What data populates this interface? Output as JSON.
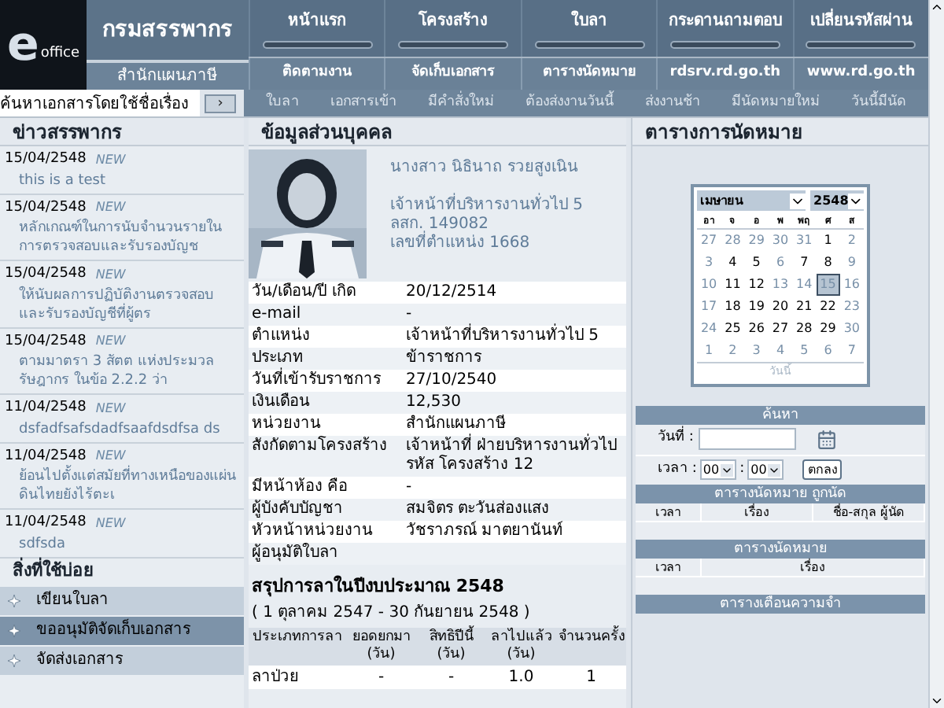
{
  "header": {
    "logo_letter": "e",
    "logo_word": "office",
    "title": "กรมสรรพากร",
    "subtitle": "สำนักแผนภาษี"
  },
  "nav_top": [
    "หน้าแรก",
    "โครงสร้าง",
    "ใบลา",
    "กระดานถามตอบ",
    "เปลี่ยนรหัสผ่าน"
  ],
  "nav_bottom": [
    "ติดตามงาน",
    "จัดเก็บเอกสาร",
    "ตารางนัดหมาย",
    "rdsrv.rd.go.th",
    "www.rd.go.th"
  ],
  "search": {
    "value": "ค้นหาเอกสารโดยใช้ชื่อเรื่อง",
    "button": "›"
  },
  "alerts": [
    {
      "label": "ใบลา",
      "active": false
    },
    {
      "label": "เอกสารเข้า",
      "active": false
    },
    {
      "label": "มีคำสั่งใหม่",
      "active": false
    },
    {
      "label": "ต้องส่งงานวันนี้",
      "active": false
    },
    {
      "label": "ส่งงานช้า",
      "active": false
    },
    {
      "label": "มีนัดหมายใหม่",
      "active": false
    },
    {
      "label": "วันนี้มีนัด",
      "active": false
    }
  ],
  "news": {
    "title": "ข่าวสรรพากร",
    "items": [
      {
        "date": "15/04/2548",
        "badge": "NEW",
        "text": "this is a test"
      },
      {
        "date": "15/04/2548",
        "badge": "NEW",
        "text": "หลักเกณฑ์ในการนับจำนวนรายในการตรวจสอบและรับรองบัญช"
      },
      {
        "date": "15/04/2548",
        "badge": "NEW",
        "text": "ให้นับผลการปฏิบัติงานตรวจสอบและรับรองบัญชีที่ผู้ตร"
      },
      {
        "date": "15/04/2548",
        "badge": "NEW",
        "text": "ตามมาตรา 3 สัตต แห่งประมวลรัษฎากร ในข้อ 2.2.2 ว่า"
      },
      {
        "date": "11/04/2548",
        "badge": "NEW",
        "text": "dsfadfsafsdadfsaafdsdfsa ds"
      },
      {
        "date": "11/04/2548",
        "badge": "NEW",
        "text": "ย้อนไปตั้งแต่สมัยที่ทางเหนือของแผ่นดินไทยยังไร้ตะเ"
      },
      {
        "date": "11/04/2548",
        "badge": "NEW",
        "text": "sdfsda"
      }
    ]
  },
  "shortcuts": {
    "title": "สิ่งที่ใช้บ่อย",
    "items": [
      {
        "label": "เขียนใบลา",
        "selected": false
      },
      {
        "label": "ขออนุมัติจัดเก็บเอกสาร",
        "selected": true
      },
      {
        "label": "จัดส่งเอกสาร",
        "selected": false
      }
    ]
  },
  "profile": {
    "title": "ข้อมูลส่วนบุคคล",
    "photo": {
      "kind": "picture"
    },
    "name_lines": [
      "นางสาว นิธินาถ รวยสูงเนิน",
      "เจ้าหน้าที่บริหารงานทั่วไป 5",
      "ลสก. 149082",
      "เลขที่ตำแหน่ง 1668"
    ],
    "details": [
      {
        "label": "วัน/เดือน/ปี เกิด",
        "value": "20/12/2514"
      },
      {
        "label": "e-mail",
        "value": "-"
      },
      {
        "label": "ตำแหน่ง",
        "value": "เจ้าหน้าที่บริหารงานทั่วไป 5"
      },
      {
        "label": "ประเภท",
        "value": "ข้าราชการ"
      },
      {
        "label": "วันที่เข้ารับราชการ",
        "value": "27/10/2540"
      },
      {
        "label": "เงินเดือน",
        "value": "12,530"
      },
      {
        "label": "หน่วยงาน",
        "value": "สำนักแผนภาษี"
      },
      {
        "label": "สังกัดตามโครงสร้าง",
        "value": "เจ้าหน้าที่ ฝ่ายบริหารงานทั่วไป รหัส โครงสร้าง 12"
      },
      {
        "label": "มีหน้าห้อง คือ",
        "value": "-"
      },
      {
        "label": "ผู้บังคับบัญชา",
        "value": "สมจิตร ตะวันส่องแสง"
      },
      {
        "label": "หัวหน้าหน่วยงาน",
        "value": "วัชราภรณ์ มาตยานันท์"
      },
      {
        "label": "ผู้อนุมัติใบลา"
      }
    ]
  },
  "leave_summary": {
    "title": "สรุปการลาในปีงบประมาณ 2548",
    "period": "( 1 ตุลาคม 2547 - 30 กันยายน 2548 )",
    "columns": [
      "ประเภทการลา",
      "ยอดยกมา (วัน)",
      "สิทธิปีนี้ (วัน)",
      "ลาไปแล้ว (วัน)",
      "จำนวนครั้ง"
    ],
    "rows": [
      [
        "ลาป่วย",
        "-",
        "-",
        "1.0",
        "1"
      ]
    ]
  },
  "calendar_panel": {
    "title": "ตารางการนัดหมาย",
    "month": "เมษายน",
    "year": "2548",
    "weekdays": [
      "อา",
      "จ",
      "อ",
      "พ",
      "พฤ",
      "ศ",
      "ส"
    ],
    "days": [
      {
        "label": "27",
        "muted": true,
        "selected": false
      },
      {
        "label": "28",
        "muted": true,
        "selected": false
      },
      {
        "label": "29",
        "muted": true,
        "selected": false
      },
      {
        "label": "30",
        "muted": true,
        "selected": false
      },
      {
        "label": "31",
        "muted": true,
        "selected": false
      },
      {
        "label": "1",
        "muted": false,
        "selected": false
      },
      {
        "label": "2",
        "muted": true,
        "selected": false
      },
      {
        "label": "3",
        "muted": true,
        "selected": false
      },
      {
        "label": "4",
        "muted": false,
        "selected": false
      },
      {
        "label": "5",
        "muted": false,
        "selected": false
      },
      {
        "label": "6",
        "muted": true,
        "selected": false
      },
      {
        "label": "7",
        "muted": false,
        "selected": false
      },
      {
        "label": "8",
        "muted": false,
        "selected": false
      },
      {
        "label": "9",
        "muted": true,
        "selected": false
      },
      {
        "label": "10",
        "muted": true,
        "selected": false
      },
      {
        "label": "11",
        "muted": false,
        "selected": false
      },
      {
        "label": "12",
        "muted": false,
        "selected": false
      },
      {
        "label": "13",
        "muted": true,
        "selected": false
      },
      {
        "label": "14",
        "muted": true,
        "selected": false
      },
      {
        "label": "15",
        "muted": true,
        "selected": true
      },
      {
        "label": "16",
        "muted": true,
        "selected": false
      },
      {
        "label": "17",
        "muted": true,
        "selected": false
      },
      {
        "label": "18",
        "muted": false,
        "selected": false
      },
      {
        "label": "19",
        "muted": false,
        "selected": false
      },
      {
        "label": "20",
        "muted": false,
        "selected": false
      },
      {
        "label": "21",
        "muted": false,
        "selected": false
      },
      {
        "label": "22",
        "muted": false,
        "selected": false
      },
      {
        "label": "23",
        "muted": true,
        "selected": false
      },
      {
        "label": "24",
        "muted": true,
        "selected": false
      },
      {
        "label": "25",
        "muted": false,
        "selected": false
      },
      {
        "label": "26",
        "muted": false,
        "selected": false
      },
      {
        "label": "27",
        "muted": false,
        "selected": false
      },
      {
        "label": "28",
        "muted": false,
        "selected": false
      },
      {
        "label": "29",
        "muted": false,
        "selected": false
      },
      {
        "label": "30",
        "muted": true,
        "selected": false
      },
      {
        "label": "1",
        "muted": true,
        "selected": false
      },
      {
        "label": "2",
        "muted": true,
        "selected": false
      },
      {
        "label": "3",
        "muted": true,
        "selected": false
      },
      {
        "label": "4",
        "muted": true,
        "selected": false
      },
      {
        "label": "5",
        "muted": true,
        "selected": false
      },
      {
        "label": "6",
        "muted": true,
        "selected": false
      },
      {
        "label": "7",
        "muted": true,
        "selected": false
      }
    ],
    "today_link": "วันนี้"
  },
  "appointment_search": {
    "title": "ค้นหา",
    "date_label": "วันที่ :",
    "time_label": "เวลา :",
    "hour": "00",
    "minute": "00",
    "separator": ":",
    "submit": "ตกลง"
  },
  "tables": [
    {
      "title": "ตารางนัดหมาย ถูกนัด",
      "columns": [
        "เวลา",
        "เรื่อง",
        "ชื่อ-สกุล ผู้นัด"
      ]
    },
    {
      "title": "ตารางนัดหมาย",
      "columns": [
        "เวลา",
        "เรื่อง"
      ]
    },
    {
      "title": "ตารางเตือนความจำ"
    }
  ]
}
